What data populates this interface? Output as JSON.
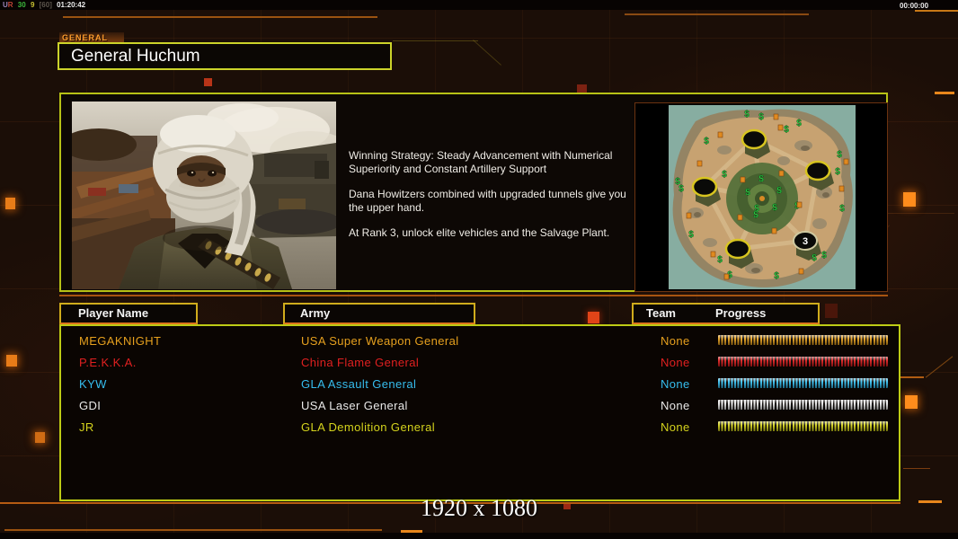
{
  "overlay": {
    "upload_flag": "U",
    "render_flag": "R",
    "fps": "30",
    "ping": "9",
    "fps_cap": "[60]",
    "clock": "01:20:42",
    "session_timer": "00:00:00"
  },
  "header": {
    "tab_label": "GENERAL",
    "general_name": "General Huchum"
  },
  "briefing": {
    "paragraphs": [
      "Winning Strategy: Steady Advancement with Numerical Superiority and Constant Artillery Support",
      "Dana Howitzers combined with upgraded tunnels give you the upper hand.",
      "At Rank 3, unlock elite vehicles and the Salvage Plant."
    ]
  },
  "map": {
    "start_position_label": "3",
    "supply_symbol": "$"
  },
  "table": {
    "headers": {
      "player": "Player Name",
      "army": "Army",
      "team": "Team",
      "progress": "Progress"
    },
    "rows": [
      {
        "name": "MEGAKNIGHT",
        "army": "USA Super Weapon General",
        "team": "None",
        "color": "#e6a01e",
        "progress": 100
      },
      {
        "name": "P.E.K.K.A.",
        "army": "China Flame General",
        "team": "None",
        "color": "#e02020",
        "progress": 100
      },
      {
        "name": "KYW",
        "army": "GLA Assault General",
        "team": "None",
        "color": "#36bdee",
        "progress": 100
      },
      {
        "name": "GDI",
        "army": "USA Laser General",
        "team": "None",
        "color": "#e9e9e9",
        "progress": 100
      },
      {
        "name": "JR",
        "army": "GLA Demolition General",
        "team": "None",
        "color": "#d5d31d",
        "progress": 100
      }
    ]
  },
  "footer": {
    "resolution": "1920 x 1080"
  },
  "colors": {
    "box_border": "#becb15",
    "header_border": "#d0ac1c",
    "accent_orange": "#e8861c",
    "tab_text": "#ff9e2e"
  }
}
